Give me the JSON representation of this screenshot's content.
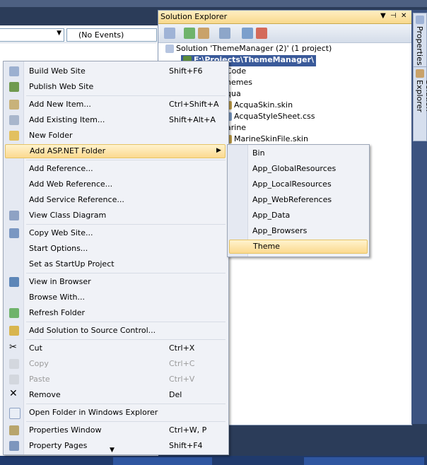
{
  "colors": {
    "accent_highlight": "#fbd98f",
    "selection": "#3a5a9a",
    "chrome": "#2b3c59"
  },
  "editor": {
    "events_combo": "(No Events)"
  },
  "solution_explorer": {
    "title": "Solution Explorer",
    "controls": [
      "▼",
      "⊣",
      "✕"
    ],
    "toolbar_icons": [
      "properties-icon",
      "refresh-icon",
      "nest-icon",
      "copy-website-icon",
      "view-class-diagram-icon",
      "asp-config-icon"
    ],
    "tree": [
      {
        "label": "Solution 'ThemeManager (2)' (1 project)",
        "icon": "solution-icon"
      },
      {
        "label": "F:\\Projects\\ThemeManager\\",
        "icon": "website-icon",
        "selected": true
      },
      {
        "label": "Code",
        "icon": "folder-icon"
      },
      {
        "label": "hemes",
        "icon": "folder-icon"
      },
      {
        "label": "qua",
        "icon": "folder-icon"
      },
      {
        "label": "AcquaSkin.skin",
        "icon": "skin-file-icon"
      },
      {
        "label": "AcquaStyleSheet.css",
        "icon": "css-file-icon"
      },
      {
        "label": "arine",
        "icon": "folder-icon"
      },
      {
        "label": "MarineSkinFile.skin",
        "icon": "skin-file-icon"
      }
    ]
  },
  "side_tabs": [
    {
      "label": "Properties"
    },
    {
      "label": "Solution Explorer"
    }
  ],
  "context_menu": {
    "items": [
      {
        "label": "Build Web Site",
        "shortcut": "Shift+F6",
        "icon": "build-icon"
      },
      {
        "label": "Publish Web Site",
        "shortcut": "",
        "icon": "publish-icon"
      },
      {
        "sep": true
      },
      {
        "label": "Add New Item...",
        "shortcut": "Ctrl+Shift+A",
        "icon": "add-new-item-icon"
      },
      {
        "label": "Add Existing Item...",
        "shortcut": "Shift+Alt+A",
        "icon": "add-existing-item-icon"
      },
      {
        "label": "New Folder",
        "shortcut": "",
        "icon": "new-folder-icon"
      },
      {
        "label": "Add ASP.NET Folder",
        "shortcut": "",
        "icon": "",
        "submenu": true,
        "highlighted": true
      },
      {
        "sep": true
      },
      {
        "label": "Add Reference...",
        "shortcut": "",
        "icon": ""
      },
      {
        "label": "Add Web Reference...",
        "shortcut": "",
        "icon": ""
      },
      {
        "label": "Add Service Reference...",
        "shortcut": "",
        "icon": ""
      },
      {
        "label": "View Class Diagram",
        "shortcut": "",
        "icon": "class-diagram-icon"
      },
      {
        "sep": true
      },
      {
        "label": "Copy Web Site...",
        "shortcut": "",
        "icon": "copy-website-icon"
      },
      {
        "label": "Start Options...",
        "shortcut": "",
        "icon": ""
      },
      {
        "label": "Set as StartUp Project",
        "shortcut": "",
        "icon": ""
      },
      {
        "sep": true
      },
      {
        "label": "View in Browser",
        "shortcut": "",
        "icon": "view-in-browser-icon"
      },
      {
        "label": "Browse With...",
        "shortcut": "",
        "icon": ""
      },
      {
        "label": "Refresh Folder",
        "shortcut": "",
        "icon": "refresh-icon"
      },
      {
        "sep": true
      },
      {
        "label": "Add Solution to Source Control...",
        "shortcut": "",
        "icon": "source-control-icon"
      },
      {
        "sep": true
      },
      {
        "label": "Cut",
        "shortcut": "Ctrl+X",
        "icon": "cut-icon"
      },
      {
        "label": "Copy",
        "shortcut": "Ctrl+C",
        "icon": "copy-icon",
        "disabled": true
      },
      {
        "label": "Paste",
        "shortcut": "Ctrl+V",
        "icon": "paste-icon",
        "disabled": true
      },
      {
        "label": "Remove",
        "shortcut": "Del",
        "icon": "remove-icon"
      },
      {
        "sep": true
      },
      {
        "label": "Open Folder in Windows Explorer",
        "shortcut": "",
        "icon": "open-folder-icon"
      },
      {
        "sep": true
      },
      {
        "label": "Properties Window",
        "shortcut": "Ctrl+W, P",
        "icon": "properties-window-icon"
      },
      {
        "label": "Property Pages",
        "shortcut": "Shift+F4",
        "icon": "property-pages-icon"
      }
    ],
    "more_indicator": "▼"
  },
  "submenu": {
    "items": [
      {
        "label": "Bin"
      },
      {
        "label": "App_GlobalResources"
      },
      {
        "label": "App_LocalResources"
      },
      {
        "label": "App_WebReferences"
      },
      {
        "label": "App_Data"
      },
      {
        "label": "App_Browsers"
      },
      {
        "label": "Theme",
        "highlighted": true
      }
    ]
  }
}
